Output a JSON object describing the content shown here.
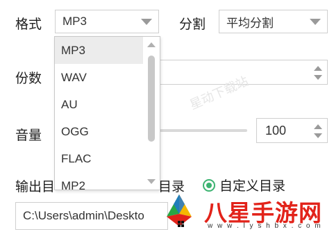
{
  "format": {
    "label": "格式",
    "value": "MP3"
  },
  "split": {
    "label": "分割",
    "value": "平均分割"
  },
  "copies": {
    "label": "份数"
  },
  "volume": {
    "label": "音量",
    "value": "100"
  },
  "output": {
    "label": "输出目",
    "option_partial": "目录",
    "custom_label": "自定义目录",
    "path": "C:\\Users\\admin\\Deskto"
  },
  "dropdown": {
    "options": [
      "MP3",
      "WAV",
      "AU",
      "OGG",
      "FLAC",
      "MP2"
    ],
    "selected_index": 0
  },
  "watermark": "星动下载站",
  "brand": {
    "name": "八星手游网",
    "url": "w w w . l y s h b x . c o m"
  },
  "colors": {
    "accent": "#3cb371",
    "brand_red": "#e2231a"
  }
}
